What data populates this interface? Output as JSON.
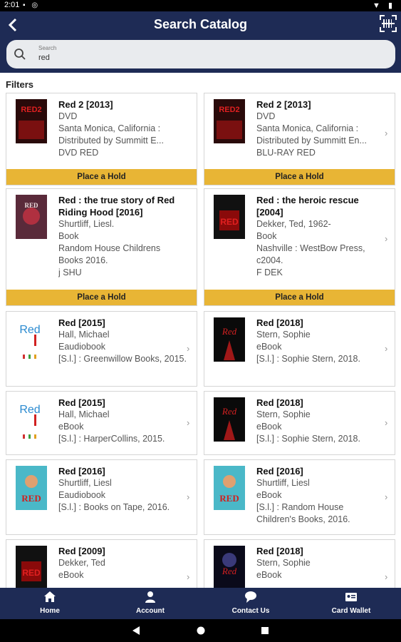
{
  "status_bar": {
    "time": "2:01"
  },
  "header": {
    "title": "Search Catalog"
  },
  "search": {
    "label": "Search",
    "value": "red"
  },
  "filters_label": "Filters",
  "hold_label": "Place a Hold",
  "results": [
    {
      "title": "Red 2 [2013]",
      "lines": [
        "DVD",
        "Santa Monica, California : Distributed by Summitt E...",
        "DVD RED"
      ],
      "hold": true
    },
    {
      "title": "Red 2 [2013]",
      "lines": [
        "DVD",
        "Santa Monica, California : Distributed by Summitt En...",
        "BLU-RAY RED"
      ],
      "hold": true
    },
    {
      "title": "Red : the true story of Red Riding Hood [2016]",
      "lines": [
        "Shurtliff, Liesl.",
        "Book",
        "Random House Childrens Books 2016.",
        "j SHU"
      ],
      "hold": true
    },
    {
      "title": "Red : the heroic rescue [2004]",
      "lines": [
        "Dekker, Ted, 1962-",
        "Book",
        "Nashville : WestBow Press, c2004.",
        "F DEK"
      ],
      "hold": true
    },
    {
      "title": "Red [2015]",
      "lines": [
        "Hall, Michael",
        "Eaudiobook",
        "[S.l.] : Greenwillow Books, 2015."
      ],
      "hold": false
    },
    {
      "title": "Red [2018]",
      "lines": [
        "Stern, Sophie",
        "eBook",
        "[S.l.] : Sophie Stern, 2018."
      ],
      "hold": false
    },
    {
      "title": "Red [2015]",
      "lines": [
        "Hall, Michael",
        "eBook",
        "[S.l.] : HarperCollins, 2015."
      ],
      "hold": false
    },
    {
      "title": "Red [2018]",
      "lines": [
        "Stern, Sophie",
        "eBook",
        "[S.l.] : Sophie Stern, 2018."
      ],
      "hold": false
    },
    {
      "title": "Red [2016]",
      "lines": [
        "Shurtliff, Liesl",
        "Eaudiobook",
        "[S.l.] : Books on Tape, 2016."
      ],
      "hold": false
    },
    {
      "title": "Red [2016]",
      "lines": [
        "Shurtliff, Liesl",
        "eBook",
        "[S.l.] : Random House Children's Books, 2016."
      ],
      "hold": false
    },
    {
      "title": "Red [2009]",
      "lines": [
        "Dekker, Ted",
        "eBook"
      ],
      "hold": false
    },
    {
      "title": "Red [2018]",
      "lines": [
        "Stern, Sophie",
        "eBook"
      ],
      "hold": false
    }
  ],
  "bottom_nav": [
    {
      "label": "Home",
      "icon": "home-icon"
    },
    {
      "label": "Account",
      "icon": "account-icon"
    },
    {
      "label": "Contact Us",
      "icon": "chat-icon"
    },
    {
      "label": "Card Wallet",
      "icon": "card-icon"
    }
  ],
  "colors": {
    "header": "#1e2b55",
    "accent": "#e8b535"
  }
}
